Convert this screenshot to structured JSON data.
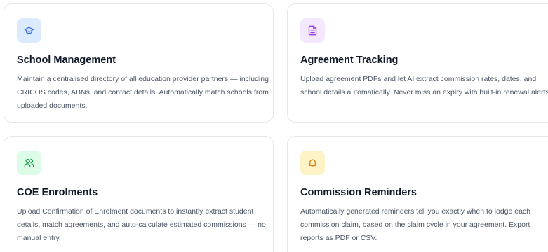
{
  "colors": {
    "blue_bg": "#dbeafe",
    "blue_fg": "#2563eb",
    "purple_bg": "#f3e8ff",
    "purple_fg": "#9333ea",
    "green_bg": "#dcfce7",
    "green_fg": "#16a34a",
    "yellow_bg": "#fef3c7",
    "yellow_fg": "#d97706"
  },
  "features": [
    {
      "icon": "graduation-cap-icon",
      "title": "School Management",
      "description": "Maintain a centralised directory of all education provider partners — including CRICOS codes, ABNs, and contact details. Automatically match schools from uploaded documents."
    },
    {
      "icon": "document-icon",
      "title": "Agreement Tracking",
      "description": "Upload agreement PDFs and let AI extract commission rates, dates, and school details automatically. Never miss an expiry with built-in renewal alerts."
    },
    {
      "icon": "users-icon",
      "title": "COE Enrolments",
      "description": "Upload Confirmation of Enrolment documents to instantly extract student details, match agreements, and auto-calculate estimated commissions — no manual entry."
    },
    {
      "icon": "bell-icon",
      "title": "Commission Reminders",
      "description": "Automatically generated reminders tell you exactly when to lodge each commission claim, based on the claim cycle in your agreement. Export reports as PDF or CSV."
    }
  ]
}
